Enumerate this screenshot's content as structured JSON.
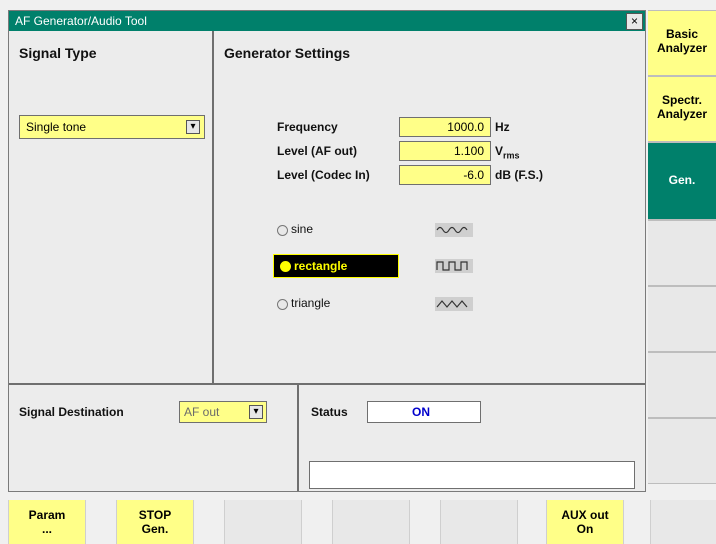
{
  "window": {
    "title": "AF Generator/Audio Tool",
    "close_glyph": "×"
  },
  "signal_type": {
    "title": "Signal Type",
    "selected": "Single tone"
  },
  "generator_settings": {
    "title": "Generator Settings",
    "frequency": {
      "label": "Frequency",
      "value": "1000.0",
      "unit": "Hz"
    },
    "level_af_out": {
      "label": "Level (AF out)",
      "value": "1.100",
      "unit": "V",
      "unit_sub": "rms"
    },
    "level_codec_in": {
      "label": "Level (Codec In)",
      "value": "-6.0",
      "unit": "dB (F.S.)"
    },
    "waveforms": [
      {
        "label": "sine",
        "selected": false
      },
      {
        "label": "rectangle",
        "selected": true
      },
      {
        "label": "triangle",
        "selected": false
      }
    ]
  },
  "signal_destination": {
    "label": "Signal Destination",
    "value": "AF out"
  },
  "status": {
    "label": "Status",
    "value": "ON"
  },
  "right_softkeys": [
    {
      "label_line1": "Basic",
      "label_line2": "Analyzer"
    },
    {
      "label_line1": "Spectr.",
      "label_line2": "Analyzer"
    },
    {
      "label_line1": "Gen.",
      "label_line2": ""
    }
  ],
  "bottom_softkeys": [
    {
      "label_line1": "Param",
      "label_line2": "..."
    },
    {
      "label_line1": "STOP",
      "label_line2": "Gen."
    },
    {
      "label_line1": "AUX out",
      "label_line2": "On"
    }
  ],
  "colors": {
    "title_bar": "#00806b",
    "field_yellow": "#ffff88",
    "status_text": "#0000cc",
    "selected_radio_bg": "#000000"
  }
}
